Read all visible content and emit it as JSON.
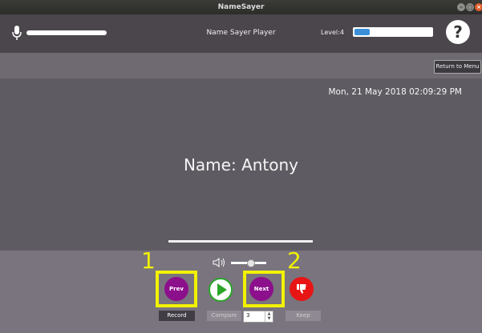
{
  "window": {
    "title": "NameSayer"
  },
  "header": {
    "title": "Name Sayer Player",
    "level_label": "Level:4",
    "help_label": "?",
    "level_progress_fraction": 0.2
  },
  "nav": {
    "return_label": "Return to Menu"
  },
  "display": {
    "datetime": "Mon, 21 May 2018 02:09:29 PM",
    "name": "Name: Antony"
  },
  "controls": {
    "prev_label": "Prev",
    "next_label": "Next",
    "record_label": "Record",
    "compare_label": "Compare",
    "keep_label": "Keep",
    "repeat_count": "3",
    "volume_fraction": 0.55
  },
  "annotations": {
    "one": "1",
    "two": "2"
  },
  "colors": {
    "prev_next": "#8c0f8c",
    "play": "#2aa52a",
    "thumbs_down": "#e81515",
    "highlight": "#f2f200",
    "level_fill": "#3a8fd6"
  },
  "icons": {
    "mic": "microphone-icon",
    "volume": "speaker-icon",
    "play": "play-icon",
    "thumbs_down": "thumbs-down-icon"
  }
}
